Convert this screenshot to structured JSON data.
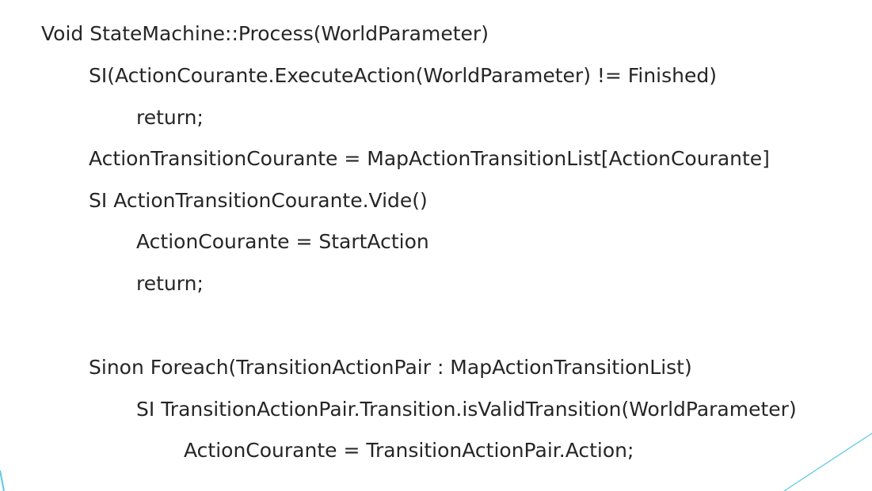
{
  "code_lines": [
    "Void StateMachine::Process(WorldParameter)",
    "SI(ActionCourante.ExecuteAction(WorldParameter) != Finished)",
    "return;",
    "ActionTransitionCourante = MapActionTransitionList[ActionCourante]",
    "SI ActionTransitionCourante.Vide()",
    "ActionCourante = StartAction",
    "return;",
    "Sinon Foreach(TransitionActionPair : MapActionTransitionList)",
    "SI TransitionActionPair.Transition.isValidTransition(WorldParameter)",
    "ActionCourante = TransitionActionPair.Action;"
  ],
  "colors": {
    "text": "#262626",
    "background": "#ffffff",
    "accent_line": "#5bc8e8"
  }
}
